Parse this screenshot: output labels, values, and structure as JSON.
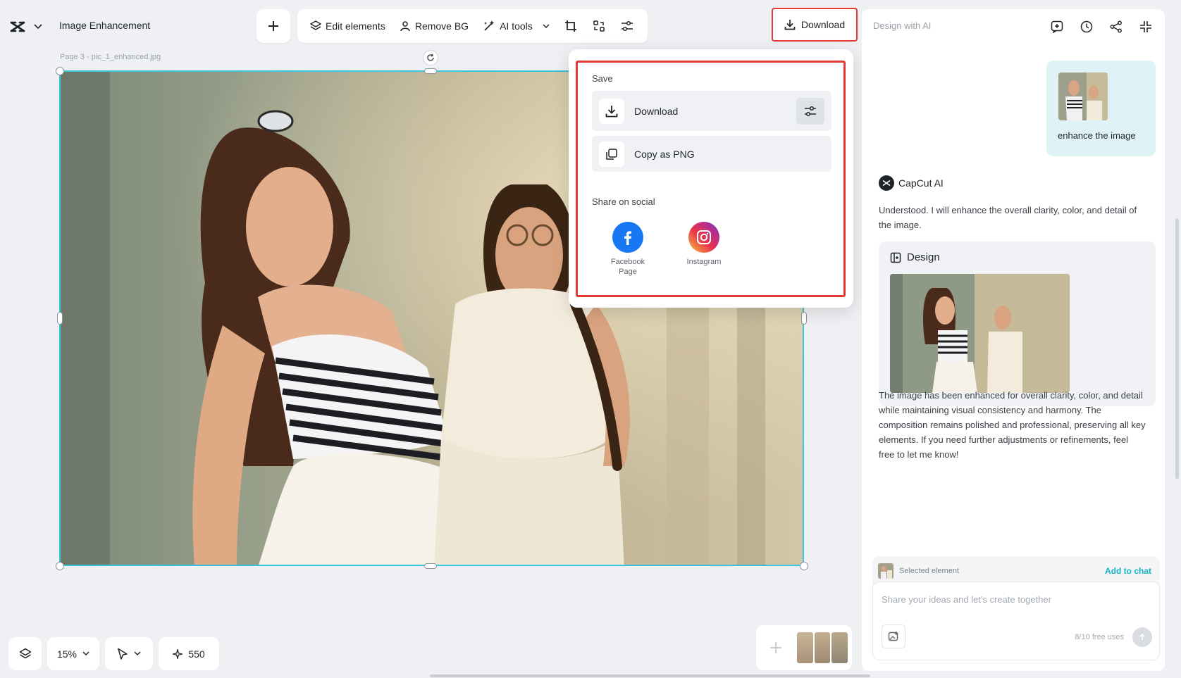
{
  "header": {
    "doc_title": "Image Enhancement",
    "download_label": "Download"
  },
  "toolbar": {
    "edit_elements": "Edit elements",
    "remove_bg": "Remove BG",
    "ai_tools": "AI tools"
  },
  "canvas": {
    "page_label": "Page 3 -  pic_1_enhanced.jpg"
  },
  "download_menu": {
    "save_title": "Save",
    "download_label": "Download",
    "copy_png_label": "Copy as PNG",
    "share_title": "Share on social",
    "facebook_label": "Facebook Page",
    "instagram_label": "Instagram"
  },
  "right_panel": {
    "title": "Design with AI",
    "user_message": "enhance the image",
    "ai_name": "CapCut AI",
    "ai_intro": "Understood. I will enhance the overall clarity, color, and detail of the image.",
    "design_card_title": "Design",
    "ai_result": "The image has been enhanced for overall clarity, color, and detail while maintaining visual consistency and harmony. The composition remains polished and professional, preserving all key elements. If you need further adjustments or refinements, feel free to let me know!",
    "selected_element": "Selected element",
    "add_to_chat": "Add to chat",
    "input_placeholder": "Share your ideas and let's create together",
    "free_uses": "8/10 free uses"
  },
  "bottom_bar": {
    "zoom": "15%",
    "credits": "550"
  },
  "colors": {
    "highlight": "#e53935",
    "selection": "#39c3dc",
    "accent": "#14b5c9",
    "facebook": "#1877f2"
  }
}
